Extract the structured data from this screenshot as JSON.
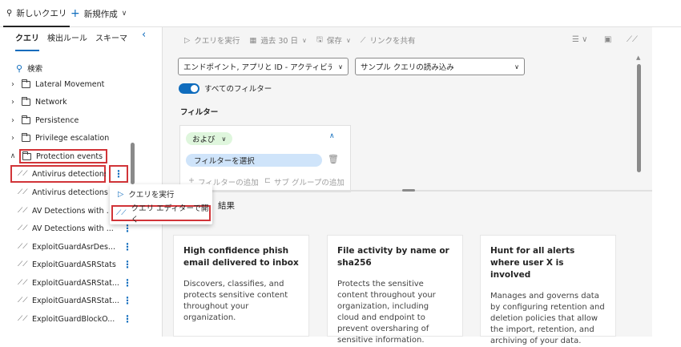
{
  "topbar": {
    "tab_new_query": "新しいクエリ",
    "tab_new_create": "新規作成"
  },
  "left": {
    "subtabs": [
      "クエリ",
      "検出ルール",
      "スキーマ"
    ],
    "search_label": "検索",
    "folders": [
      "Lateral Movement",
      "Network",
      "Persistence",
      "Privilege escalation",
      "Protection events"
    ],
    "queries": [
      "Antivirus detections",
      "Antivirus detections ...",
      "AV Detections with ...",
      "AV Detections with ...",
      "ExploitGuardAsrDes...",
      "ExploitGuardASRStats",
      "ExploitGuardASRStat...",
      "ExploitGuardASRStat...",
      "ExploitGuardBlockO..."
    ]
  },
  "context_menu": {
    "run_query": "クエリを実行",
    "open_in_editor": "クエリ エディターで開く"
  },
  "toolbar": {
    "run_query": "クエリを実行",
    "time_range": "過去 30 日",
    "save": "保存",
    "share_link": "リンクを共有"
  },
  "query_builder": {
    "source_select": "エンドポイント, アプリと ID - アクティビティ ログ...",
    "sample_select": "サンプル クエリの読み込み",
    "all_filters": "すべてのフィルター",
    "filter_heading": "フィルター",
    "and_pill": "および",
    "select_filter": "フィルターを選択",
    "add_filter": "フィルターの追加",
    "add_subgroup": "サブ グループの追加"
  },
  "results": {
    "heading": "結果",
    "cards": [
      {
        "title": "High confidence phish email delivered to inbox",
        "desc": "Discovers, classifies, and protects sensitive content throughout your organization."
      },
      {
        "title": "File activity by name or sha256",
        "desc": "Protects the sensitive content throughout your organization, including cloud and endpoint to prevent oversharing of sensitive information."
      },
      {
        "title": "Hunt for all alerts where user X is involved",
        "desc": "Manages and governs data by configuring retention and deletion policies that allow the import, retention, and archiving of your data."
      }
    ]
  },
  "colors": {
    "accent": "#0f6cbd",
    "highlight_box": "#d13438",
    "and_pill": "#dff6dd",
    "filter_pill": "#cfe4fa"
  }
}
